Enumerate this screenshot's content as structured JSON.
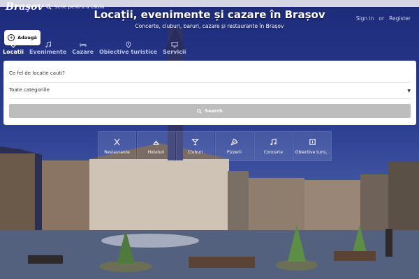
{
  "header": {
    "logo_text": "Brașov",
    "search_label": "Scrie pentru a căuta",
    "sign_in": "Sign in",
    "or": "or",
    "register": "Register"
  },
  "add_button": {
    "label": "Adaugă"
  },
  "hero": {
    "title": "Locații, evenimente și cazare în Brașov",
    "subtitle": "Concerte, cluburi, baruri, cazare și restaurante în Brașov"
  },
  "tabs": [
    {
      "label": "Locatii",
      "icon": "heart-icon",
      "active": true
    },
    {
      "label": "Evenimente",
      "icon": "music-icon"
    },
    {
      "label": "Cazare",
      "icon": "bed-icon"
    },
    {
      "label": "Obiective turistice",
      "icon": "map-pin-icon"
    },
    {
      "label": "Servicii",
      "icon": "monitor-icon"
    }
  ],
  "form": {
    "question": "Ce fel de locatie cauti?",
    "select_value": "Toate categoriile",
    "search_button": "Search"
  },
  "categories": [
    {
      "label": "Restaurante",
      "icon": "utensils-icon"
    },
    {
      "label": "Hoteluri",
      "icon": "bell-icon"
    },
    {
      "label": "Cluburi",
      "icon": "cocktail-icon"
    },
    {
      "label": "Pizzerii",
      "icon": "pizza-icon"
    },
    {
      "label": "Concerte",
      "icon": "music-note-icon"
    },
    {
      "label": "Obiective turis...",
      "icon": "map-icon"
    }
  ],
  "colors": {
    "accent": "#2c3e91",
    "tab_inactive": "#b8c4ea",
    "search_button": "#bdbdbd"
  }
}
